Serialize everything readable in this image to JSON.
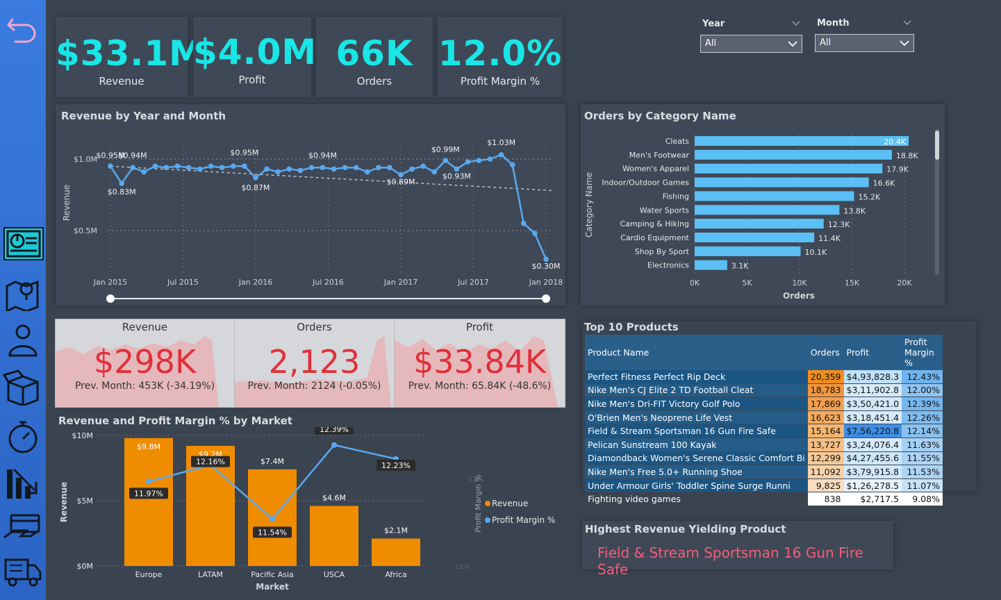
{
  "kpis": [
    {
      "value": "$33.1M",
      "label": "Revenue"
    },
    {
      "value": "$4.0M",
      "label": "Profit"
    },
    {
      "value": "66K",
      "label": "Orders"
    },
    {
      "value": "12.0%",
      "label": "Profit Margin %"
    }
  ],
  "slicers": {
    "year": {
      "label": "Year",
      "value": "All"
    },
    "month": {
      "label": "Month",
      "value": "All"
    }
  },
  "line_panel": {
    "title": "Revenue by Year and Month",
    "ylabel": "Revenue",
    "yticks": [
      "$1.0M",
      "$0.5M"
    ],
    "xticks": [
      "Jan 2015",
      "Jul 2015",
      "Jan 2016",
      "Jul 2016",
      "Jan 2017",
      "Jul 2017",
      "Jan 2018"
    ]
  },
  "bar_panel": {
    "title": "Orders by Category Name",
    "ylabel": "Category Name",
    "xlabel": "Orders",
    "xticks": [
      "0K",
      "5K",
      "10K",
      "15K",
      "20K"
    ]
  },
  "cards": [
    {
      "title": "Revenue",
      "value": "$298K",
      "sub": "Prev. Month: 453K (-34.19%)"
    },
    {
      "title": "Orders",
      "value": "2,123",
      "sub": "Prev. Month: 2124 (-0.05%)"
    },
    {
      "title": "Profit",
      "value": "$33.84K",
      "sub": "Prev. Month: 65.84K (-48.6%)"
    }
  ],
  "combo_panel": {
    "title": "Revenue and Profit Margin % by Market",
    "ylabel": "Revenue",
    "y2label": "Profit Margin %",
    "xlabel": "Market",
    "yticks": [
      "$10M",
      "$5M",
      "$0M"
    ],
    "y2ticks": [
      "12%",
      "11%"
    ],
    "legend": [
      "Revenue",
      "Profit Margin %"
    ]
  },
  "top_products": {
    "title": "Top 10 Products",
    "headers": [
      "Product Name",
      "Orders",
      "Profit",
      "Profit Margin %"
    ],
    "rows": [
      [
        "Perfect Fitness Perfect Rip Deck",
        "20,359",
        "$4,93,828.3",
        "12.43%"
      ],
      [
        "Nike Men's CJ Elite 2 TD Football Cleat",
        "18,783",
        "$3,11,902.8",
        "12.00%"
      ],
      [
        "Nike Men's Dri-FIT Victory Golf Polo",
        "17,869",
        "$3,50,421.0",
        "12.39%"
      ],
      [
        "O'Brien Men's Neoprene Life Vest",
        "16,623",
        "$3,18,451.4",
        "12.26%"
      ],
      [
        "Field & Stream Sportsman 16 Gun Fire Safe",
        "15,164",
        "$7,56,220.8",
        "12.14%"
      ],
      [
        "Pelican Sunstream 100 Kayak",
        "13,727",
        "$3,24,076.4",
        "11.63%"
      ],
      [
        "Diamondback Women's Serene Classic Comfort Bi",
        "12,299",
        "$4,27,455.6",
        "11.55%"
      ],
      [
        "Nike Men's Free 5.0+ Running Shoe",
        "11,092",
        "$3,79,915.8",
        "11.53%"
      ],
      [
        "Under Armour Girls' Toddler Spine Surge Runni",
        "9,825",
        "$1,26,278.5",
        "11.07%"
      ],
      [
        "Fighting video games",
        "838",
        "$2,717.5",
        "9.08%"
      ]
    ]
  },
  "highest": {
    "title": "HIghest Revenue Yielding Product",
    "value": "Field & Stream Sportsman 16 Gun Fire Safe"
  },
  "colors": {
    "accent": "#19e6e6",
    "bar": "#5bc0f5",
    "orange": "#f08c00",
    "line": "#5aa9f0",
    "red": "#e0303a"
  },
  "chart_data": [
    {
      "type": "line",
      "title": "Revenue by Year and Month",
      "ylabel": "Revenue",
      "ylim": [
        0.25,
        1.1
      ],
      "x": [
        "Jan 2015",
        "Feb 2015",
        "Mar 2015",
        "Apr 2015",
        "May 2015",
        "Jun 2015",
        "Jul 2015",
        "Aug 2015",
        "Sep 2015",
        "Oct 2015",
        "Nov 2015",
        "Dec 2015",
        "Jan 2016",
        "Feb 2016",
        "Mar 2016",
        "Apr 2016",
        "May 2016",
        "Jun 2016",
        "Jul 2016",
        "Aug 2016",
        "Sep 2016",
        "Oct 2016",
        "Nov 2016",
        "Dec 2016",
        "Jan 2017",
        "Feb 2017",
        "Mar 2017",
        "Apr 2017",
        "May 2017",
        "Jun 2017",
        "Jul 2017",
        "Aug 2017",
        "Sep 2017",
        "Oct 2017",
        "Nov 2017",
        "Dec 2017",
        "Jan 2018"
      ],
      "values": [
        0.95,
        0.83,
        0.94,
        0.91,
        0.95,
        0.94,
        0.95,
        0.94,
        0.93,
        0.95,
        0.94,
        0.95,
        0.95,
        0.87,
        0.93,
        0.91,
        0.93,
        0.92,
        0.94,
        0.94,
        0.93,
        0.94,
        0.94,
        0.91,
        0.94,
        0.94,
        0.89,
        0.93,
        0.95,
        0.91,
        0.99,
        0.93,
        0.98,
        0.99,
        1.0,
        1.03,
        0.96,
        0.55,
        0.48,
        0.3
      ],
      "labels": [
        "$0.95M",
        "$0.83M",
        "$0.94M",
        "$0.95M",
        "$0.87M",
        "$0.94M",
        "$0.89M",
        "$0.99M",
        "$0.93M",
        "$1.03M",
        "$0.30M"
      ],
      "trend": true
    },
    {
      "type": "bar",
      "title": "Orders by Category Name",
      "categories": [
        "Cleats",
        "Men's Footwear",
        "Women's Apparel",
        "Indoor/Outdoor Games",
        "Fishing",
        "Water Sports",
        "Camping & Hiking",
        "Cardio Equipment",
        "Shop By Sport",
        "Electronics"
      ],
      "values": [
        20.4,
        18.8,
        17.9,
        16.6,
        15.2,
        13.8,
        12.3,
        11.4,
        10.1,
        3.1
      ],
      "value_labels": [
        "20.4K",
        "18.8K",
        "17.9K",
        "16.6K",
        "15.2K",
        "13.8K",
        "12.3K",
        "11.4K",
        "10.1K",
        "3.1K"
      ],
      "xlim": [
        0,
        20
      ],
      "xlabel": "Orders",
      "ylabel": "Category Name"
    },
    {
      "type": "bar",
      "title": "Revenue and Profit Margin % by Market",
      "categories": [
        "Europe",
        "LATAM",
        "Pacific Asia",
        "USCA",
        "Africa"
      ],
      "series": [
        {
          "name": "Revenue",
          "values": [
            9.8,
            9.2,
            7.4,
            4.6,
            2.1
          ],
          "labels": [
            "$9.8M",
            "$9.2M",
            "$7.4M",
            "$4.6M",
            "$2.1M"
          ]
        },
        {
          "name": "Profit Margin %",
          "values": [
            11.97,
            12.16,
            11.54,
            12.39,
            12.23
          ],
          "labels": [
            "11.97%",
            "12.16%",
            "11.54%",
            "12.39%",
            "12.23%"
          ]
        }
      ],
      "ylim": [
        0,
        10
      ],
      "y2lim": [
        11,
        12.5
      ]
    }
  ]
}
